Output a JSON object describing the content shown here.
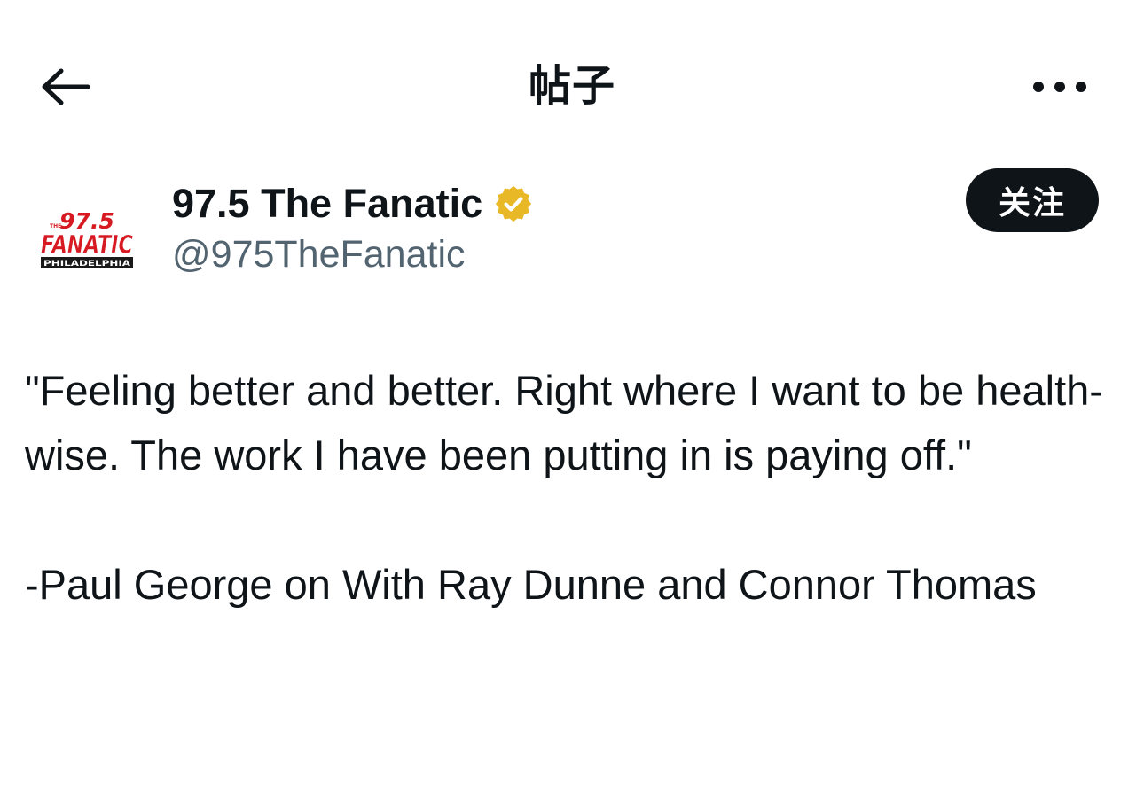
{
  "header": {
    "title": "帖子",
    "back_icon": "arrow-left-icon",
    "more_icon": "more-horizontal-icon"
  },
  "author": {
    "name": "97.5 The Fanatic",
    "handle": "@975TheFanatic",
    "verified": true,
    "verified_color": "#e8b826",
    "avatar_logo": {
      "top": "THE",
      "number": "97.5",
      "brand": "FANATIC",
      "city": "PHILADELPHIA",
      "brand_color": "#d71a21"
    },
    "follow_label": "关注"
  },
  "tweet": {
    "paragraph1": "\"Feeling better and better. Right where I want to be health-wise. The work I have been putting in is paying off.\"",
    "paragraph2": "-Paul George on With Ray Dunne and Connor Thomas"
  },
  "colors": {
    "text_primary": "#0f1419",
    "text_secondary": "#536471",
    "button_bg": "#0f1419",
    "background": "#ffffff"
  }
}
